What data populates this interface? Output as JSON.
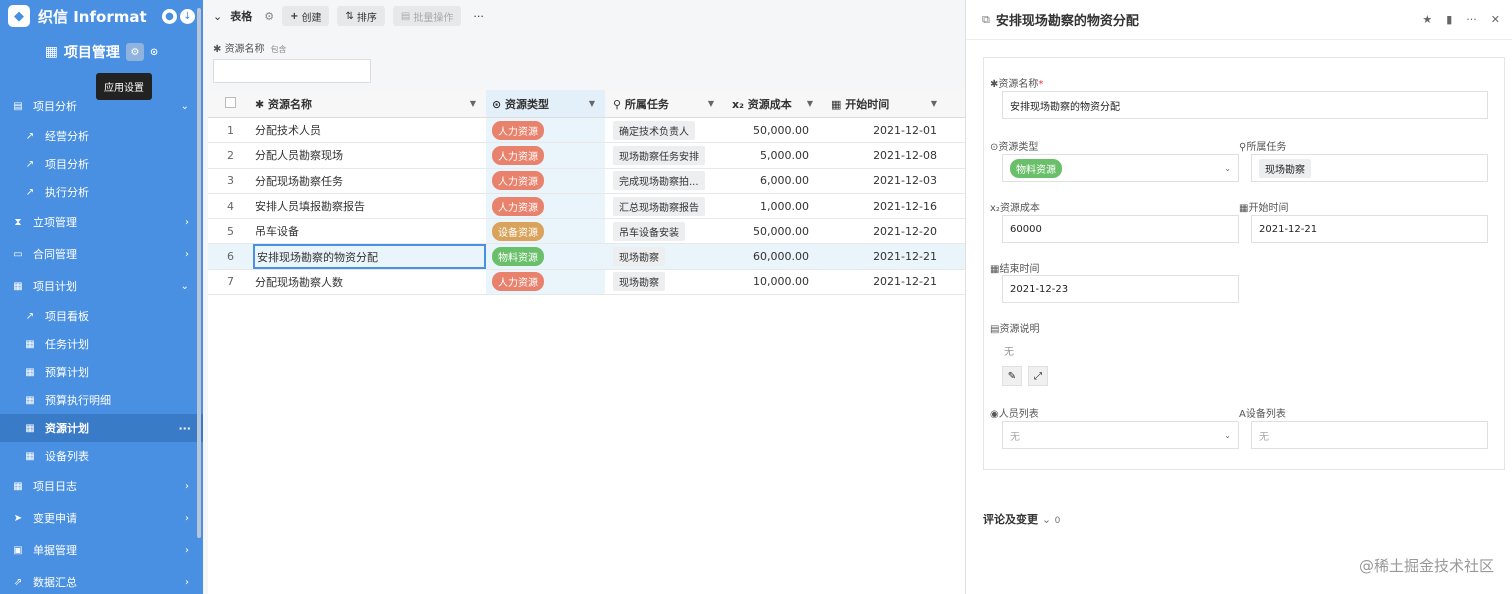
{
  "app": {
    "name": "织信 Informat",
    "project": "项目管理",
    "tooltip": "应用设置"
  },
  "nav": [
    {
      "label": "项目分析",
      "type": "group",
      "open": true
    },
    {
      "label": "经营分析",
      "type": "sub"
    },
    {
      "label": "项目分析",
      "type": "sub"
    },
    {
      "label": "执行分析",
      "type": "sub"
    },
    {
      "label": "立项管理",
      "type": "group"
    },
    {
      "label": "合同管理",
      "type": "group"
    },
    {
      "label": "项目计划",
      "type": "group",
      "open": true
    },
    {
      "label": "项目看板",
      "type": "sub"
    },
    {
      "label": "任务计划",
      "type": "sub"
    },
    {
      "label": "预算计划",
      "type": "sub"
    },
    {
      "label": "预算执行明细",
      "type": "sub"
    },
    {
      "label": "资源计划",
      "type": "sub",
      "selected": true
    },
    {
      "label": "设备列表",
      "type": "sub"
    },
    {
      "label": "项目日志",
      "type": "group"
    },
    {
      "label": "变更申请",
      "type": "group"
    },
    {
      "label": "单据管理",
      "type": "group"
    },
    {
      "label": "数据汇总",
      "type": "group"
    }
  ],
  "toolbar": {
    "view": "表格",
    "create": "创建",
    "sort": "排序",
    "batch": "批量操作",
    "more": "···"
  },
  "filter": {
    "label": "资源名称",
    "op": "包含",
    "value": ""
  },
  "table": {
    "headers": [
      "资源名称",
      "资源类型",
      "所属任务",
      "资源成本",
      "开始时间"
    ],
    "rows": [
      {
        "no": "1",
        "name": "分配技术人员",
        "type": "人力资源",
        "task": "确定技术负责人",
        "cost": "50,000.00",
        "start": "2021-12-01"
      },
      {
        "no": "2",
        "name": "分配人员勘察现场",
        "type": "人力资源",
        "task": "现场勘察任务安排",
        "cost": "5,000.00",
        "start": "2021-12-08"
      },
      {
        "no": "3",
        "name": "分配现场勘察任务",
        "type": "人力资源",
        "task": "完成现场勘察拍...",
        "cost": "6,000.00",
        "start": "2021-12-03"
      },
      {
        "no": "4",
        "name": "安排人员填报勘察报告",
        "type": "人力资源",
        "task": "汇总现场勘察报告",
        "cost": "1,000.00",
        "start": "2021-12-16"
      },
      {
        "no": "5",
        "name": "吊车设备",
        "type": "设备资源",
        "task": "吊车设备安装",
        "cost": "50,000.00",
        "start": "2021-12-20"
      },
      {
        "no": "6",
        "name": "安排现场勘察的物资分配",
        "type": "物料资源",
        "task": "现场勘察",
        "cost": "60,000.00",
        "start": "2021-12-21"
      },
      {
        "no": "7",
        "name": "分配现场勘察人数",
        "type": "人力资源",
        "task": "现场勘察",
        "cost": "10,000.00",
        "start": "2021-12-21"
      }
    ]
  },
  "colors": {
    "人力资源": "#e8826c",
    "设备资源": "#d9a35c",
    "物料资源": "#6abf6a"
  },
  "panel": {
    "title": "安排现场勘察的物资分配",
    "fields": {
      "name_label": "资源名称",
      "name_required": "*",
      "name_value": "安排现场勘察的物资分配",
      "type_label": "资源类型",
      "type_value": "物料资源",
      "task_label": "所属任务",
      "task_value": "现场勘察",
      "cost_label": "资源成本",
      "cost_value": "60000",
      "start_label": "开始时间",
      "start_value": "2021-12-21",
      "end_label": "结束时间",
      "end_value": "2021-12-23",
      "desc_label": "资源说明",
      "desc_value": "无",
      "people_label": "人员列表",
      "people_value": "无",
      "equip_label": "设备列表",
      "equip_value": "无"
    },
    "comments": "评论及变更",
    "comments_count": "0"
  },
  "watermark": "@稀土掘金技术社区"
}
